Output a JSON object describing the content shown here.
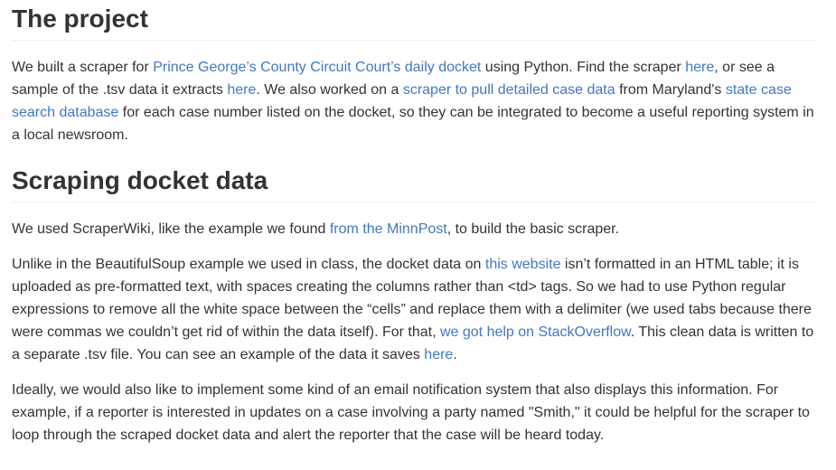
{
  "section1": {
    "heading": "The project",
    "p1": {
      "t1": "We built a scraper for ",
      "link_docket": "Prince George’s County Circuit Court’s daily docket",
      "t2": " using Python. Find the scraper ",
      "link_scraper": "here",
      "t3": ", or see a sample of the .tsv data it extracts ",
      "link_sample": "here",
      "t4": ". We also worked on a ",
      "link_detailed": "scraper to pull detailed case data",
      "t5": " from Maryland's ",
      "link_search": "state case search database",
      "t6": " for each case number listed on the docket, so they can be integrated to become a useful reporting system in a local newsroom."
    }
  },
  "section2": {
    "heading": "Scraping docket data",
    "p1": {
      "t1": "We used ScraperWiki, like the example we found ",
      "link_minnpost": "from the MinnPost",
      "t2": ", to build the basic scraper."
    },
    "p2": {
      "t1": "Unlike in the BeautifulSoup example we used in class, the docket data on ",
      "link_website": "this website",
      "t2": " isn’t formatted in an HTML table; it is uploaded as pre-formatted text, with spaces creating the columns rather than <td> tags. So we had to use Python regular expressions to remove all the white space between the “cells” and replace them with a delimiter (we used tabs because there were commas we couldn’t get rid of within the data itself). For that, ",
      "link_stackoverflow": "we got help on StackOverflow",
      "t3": ". This clean data is written to a separate .tsv file. You can see an example of the data it saves ",
      "link_here": "here",
      "t4": "."
    },
    "p3": {
      "t1": "Ideally, we would also like to implement some kind of an email notification system that also displays this information. For example, if a reporter is interested in updates on a case involving a party named \"Smith,\" it could be helpful for the scraper to loop through the scraped docket data and alert the reporter that the case will be heard today."
    }
  },
  "colors": {
    "text": "#333333",
    "link": "#4078c0",
    "rule": "#eeeeee"
  }
}
